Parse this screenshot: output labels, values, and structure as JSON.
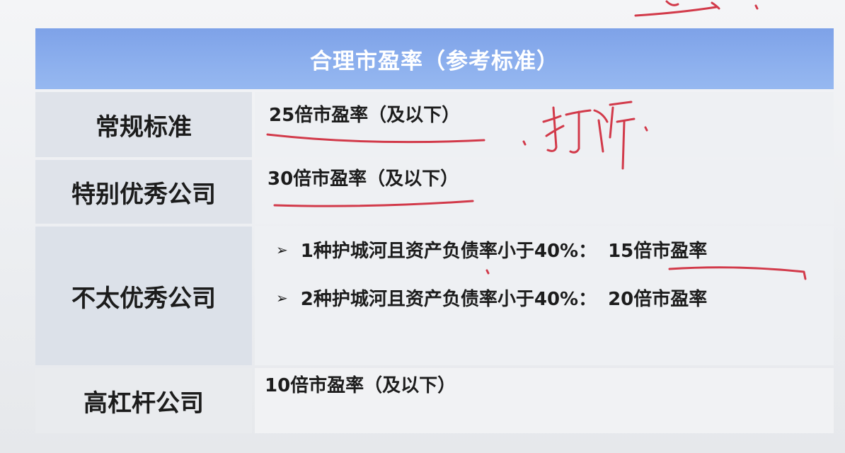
{
  "table": {
    "title": "合理市盈率（参考标准）",
    "rows": [
      {
        "label": "常规标准",
        "value": "25倍市盈率（及以下）"
      },
      {
        "label": "特别优秀公司",
        "value": "30倍市盈率（及以下）"
      },
      {
        "label": "不太优秀公司",
        "bullets": [
          {
            "text": "1种护城河且资产负债率小于40%：",
            "highlight": "15倍市盈率"
          },
          {
            "text": "2种护城河且资产负债率小于40%：",
            "highlight": "20倍市盈率"
          }
        ]
      },
      {
        "label": "高杠杆公司",
        "value": "10倍市盈率（及以下）"
      }
    ]
  },
  "colors": {
    "header_bg": "#8aaeed",
    "annotation_ink": "#d23a4a"
  },
  "icons": {
    "bullet": "arrowhead-bullet-icon"
  }
}
